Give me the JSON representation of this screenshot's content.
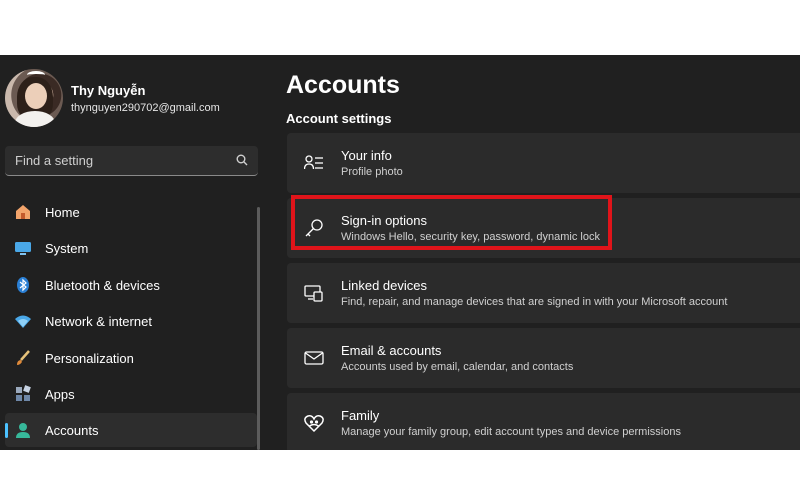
{
  "profile": {
    "name": "Thy Nguyễn",
    "email": "thynguyen290702@gmail.com"
  },
  "search": {
    "placeholder": "Find a setting",
    "icon": "search-icon"
  },
  "sidebar": {
    "items": [
      {
        "label": "Home",
        "icon": "home-icon",
        "active": false
      },
      {
        "label": "System",
        "icon": "monitor-icon",
        "active": false
      },
      {
        "label": "Bluetooth & devices",
        "icon": "bluetooth-icon",
        "active": false
      },
      {
        "label": "Network & internet",
        "icon": "wifi-icon",
        "active": false
      },
      {
        "label": "Personalization",
        "icon": "brush-icon",
        "active": false
      },
      {
        "label": "Apps",
        "icon": "apps-icon",
        "active": false
      },
      {
        "label": "Accounts",
        "icon": "person-icon",
        "active": true
      }
    ]
  },
  "main": {
    "title": "Accounts",
    "section": "Account settings",
    "cards": [
      {
        "title": "Your info",
        "subtitle": "Profile photo",
        "icon": "person-card-icon"
      },
      {
        "title": "Sign-in options",
        "subtitle": "Windows Hello, security key, password, dynamic lock",
        "icon": "key-icon",
        "highlighted": true
      },
      {
        "title": "Linked devices",
        "subtitle": "Find, repair, and manage devices that are signed in with your Microsoft account",
        "icon": "linked-devices-icon"
      },
      {
        "title": "Email & accounts",
        "subtitle": "Accounts used by email, calendar, and contacts",
        "icon": "mail-icon"
      },
      {
        "title": "Family",
        "subtitle": "Manage your family group, edit account types and device permissions",
        "icon": "family-heart-icon"
      }
    ]
  },
  "colors": {
    "background": "#202020",
    "card": "#2b2b2b",
    "accent": "#4cc2ff",
    "highlight": "#e0141a"
  }
}
